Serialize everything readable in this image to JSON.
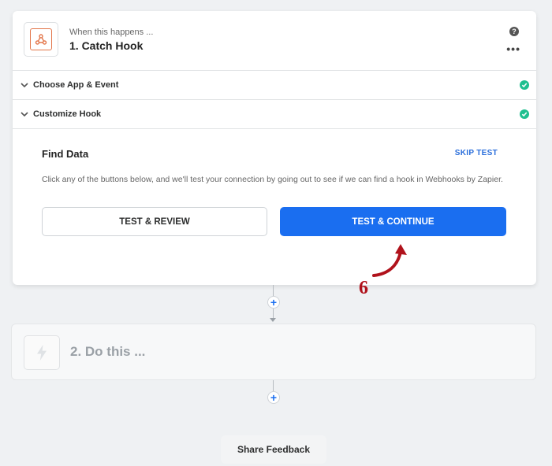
{
  "trigger": {
    "subtitle": "When this happens ...",
    "title": "1. Catch Hook",
    "help_glyph": "?",
    "more_glyph": "•••",
    "icon": "webhooks-icon"
  },
  "sections": [
    {
      "label": "Choose App & Event",
      "status": "complete"
    },
    {
      "label": "Customize Hook",
      "status": "complete"
    }
  ],
  "find_data": {
    "title": "Find Data",
    "skip_label": "SKIP TEST",
    "description": "Click any of the buttons below, and we'll test your connection by going out to see if we can find a hook in Webhooks by Zapier.",
    "test_review_label": "TEST & REVIEW",
    "test_continue_label": "TEST & CONTINUE"
  },
  "action": {
    "title": "2. Do this ...",
    "icon": "lightning-icon"
  },
  "plus_glyph": "+",
  "feedback_label": "Share Feedback",
  "annotation": {
    "number": "6"
  },
  "colors": {
    "primary": "#1a6ef0",
    "success": "#1fbf8f",
    "brand_orange": "#e3764a",
    "annotation_red": "#b0121b"
  }
}
